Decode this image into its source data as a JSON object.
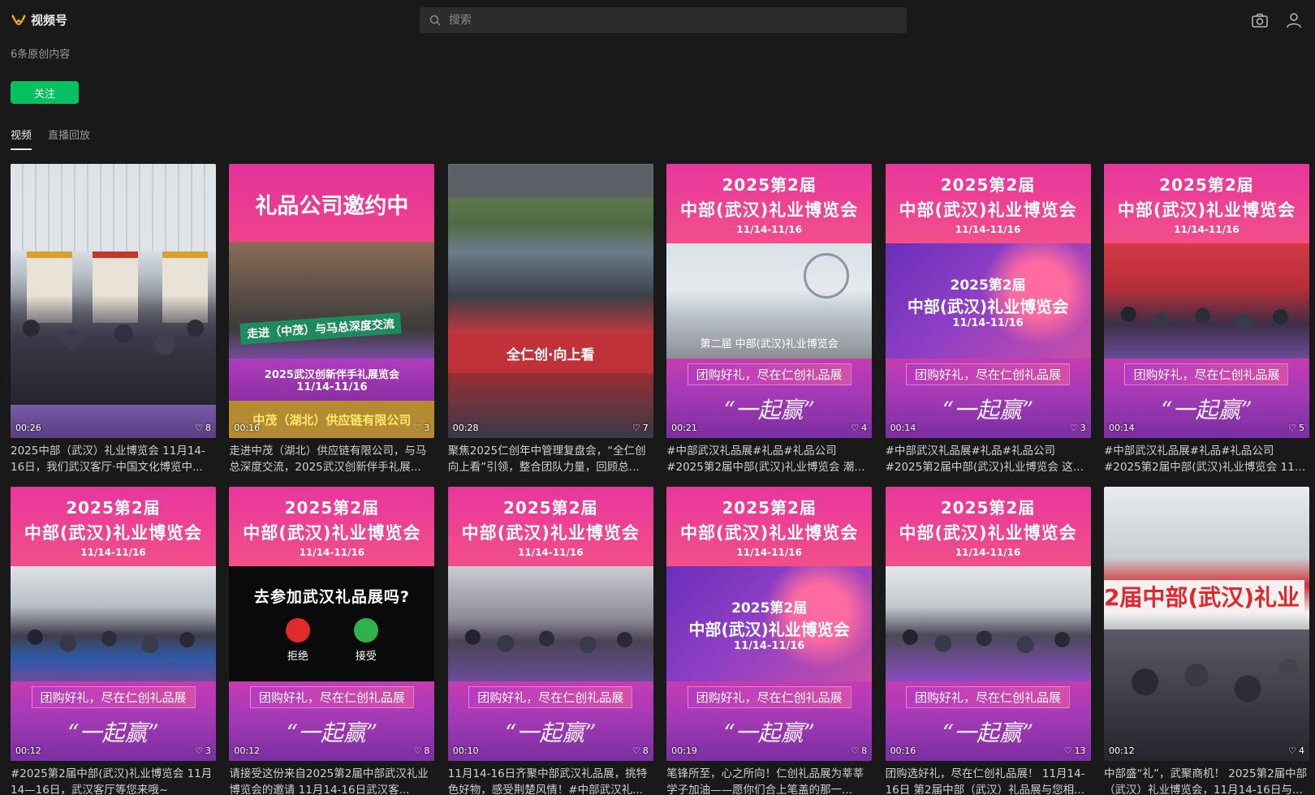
{
  "app": {
    "title": "视频号"
  },
  "search": {
    "placeholder": "搜索"
  },
  "profile": {
    "count_text": "6条原创内容",
    "follow_label": "关注"
  },
  "tabs": [
    {
      "label": "视频",
      "active": true
    },
    {
      "label": "直播回放",
      "active": false
    }
  ],
  "poster_text": {
    "line1": "2025第2届",
    "line2": "中部(武汉)礼业博览会",
    "line3": "11/14-11/16",
    "slogan": "团购好礼，尽在仁创礼品展",
    "script": "“一起赢”",
    "inner1": "2025第2届",
    "inner2": "中部(武汉)礼业博览会",
    "inner3": "11/14-11/16"
  },
  "thumb_text": {
    "meeting_banner": "全仁创·向上看",
    "ceo_head": "礼品公司邀约中",
    "ceo_strip": "走进（中茂）与马总深度交流",
    "ceo_mid1": "2025武汉创新伴手礼展览会",
    "ceo_mid2": "11/14-11/16",
    "ceo_foot": "中茂（湖北）供应链有限公司",
    "call_q": "去参加武汉礼品展吗?",
    "call_reject": "拒绝",
    "call_accept": "接受",
    "expo_big": "2届中部(武汉)礼业",
    "expo_sub": "第二届 中部(武汉)礼业博览会"
  },
  "videos": [
    {
      "duration": "00:26",
      "likes": "8",
      "desc": "2025中部（武汉）礼业博览会 11月14-16日，我们武汉客厅·中国文化博览中..."
    },
    {
      "duration": "00:16",
      "likes": "3",
      "desc": "走进中茂（湖北）供应链有限公司，与马总深度交流，2025武汉创新伴手礼展..."
    },
    {
      "duration": "00:28",
      "likes": "7",
      "desc": "聚焦2025仁创年中管理复盘会，“全仁创向上看”引领，整合团队力量，回顾总..."
    },
    {
      "duration": "00:21",
      "likes": "4",
      "desc": "#中部武汉礼品展#礼品#礼品公司#2025第2届中部(武汉)礼业博览会 潮流礼品..."
    },
    {
      "duration": "00:14",
      "likes": "3",
      "desc": "#中部武汉礼品展#礼品#礼品公司#2025第2届中部(武汉)礼业博览会 这不仅是..."
    },
    {
      "duration": "00:14",
      "likes": "5",
      "desc": "#中部武汉礼品展#礼品#礼品公司#2025第2届中部(武汉)礼业博览会 11月14-1..."
    },
    {
      "duration": "00:12",
      "likes": "3",
      "desc": "#2025第2届中部(武汉)礼业博览会 11月14—16日，武汉客厅等您来哦~"
    },
    {
      "duration": "00:12",
      "likes": "8",
      "desc": "请接受这份来自2025第2届中部武汉礼业博览会的邀请 11月14-16日武汉客..."
    },
    {
      "duration": "00:10",
      "likes": "8",
      "desc": "11月14-16日齐聚中部武汉礼品展，挑特色好物，感受荆楚风情！#中部武汉礼..."
    },
    {
      "duration": "00:19",
      "likes": "8",
      "desc": "笔锋所至，心之所向！仁创礼品展为莘莘学子加油——愿你们合上笔盖的那一..."
    },
    {
      "duration": "00:16",
      "likes": "13",
      "desc": "团购选好礼，尽在仁创礼品展！ 11月14-16日 第2届中部（武汉）礼品展与您相..."
    },
    {
      "duration": "00:12",
      "likes": "4",
      "desc": "中部盛“礼”，武聚商机！ 2025第2届中部（武汉）礼业博览会，11月14-16日与..."
    }
  ],
  "colors": {
    "accent": "#07c160",
    "background": "#191919",
    "poster_pink": "#e8369c"
  },
  "icons": [
    "wechat-channels-logo-icon",
    "search-icon",
    "camera-icon",
    "user-icon",
    "heart-icon"
  ]
}
